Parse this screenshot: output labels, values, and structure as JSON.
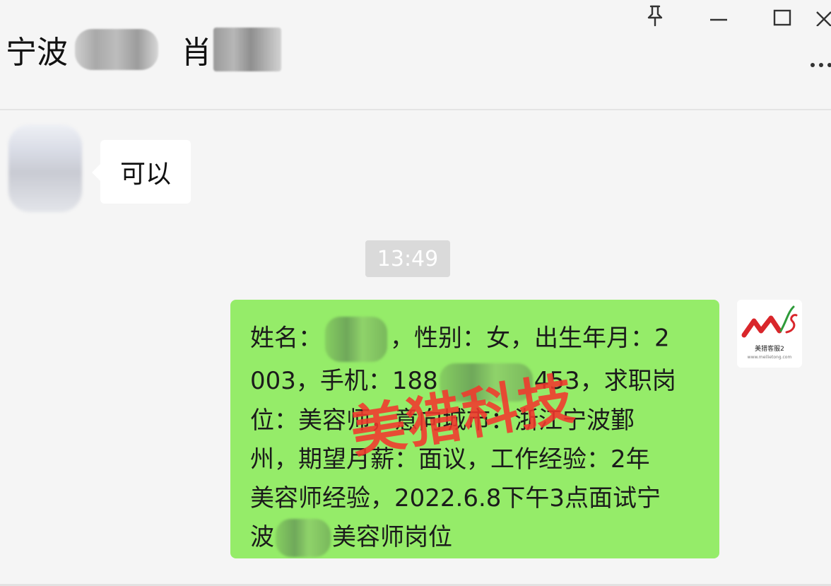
{
  "window": {
    "pin_icon": "pin-icon",
    "minimize_icon": "minimize-icon",
    "maximize_icon": "maximize-icon",
    "close_icon": "close-icon",
    "more_icon": "more-icon"
  },
  "header": {
    "title_part1": "宁波",
    "title_part2": "肖"
  },
  "messages": {
    "incoming_text": "可以",
    "timestamp": "13:49",
    "outgoing_lines": {
      "line1_a": "姓名：",
      "line1_b": "，性别：女，出生年月：2",
      "line2_a": "003，手机：188",
      "line2_b": "453，求职岗",
      "line3": "位：美容师，意向城市：浙江宁波鄞",
      "line4": "州，期望月薪：面议，工作经验：2年",
      "line5": "美容师经验，2022.6.8下午3点面试宁",
      "line6_a": "波",
      "line6_b": "美容师岗位"
    }
  },
  "watermark": {
    "text": "美猎科技"
  },
  "avatar_logo": {
    "brand_text": "美猎客服2",
    "sub_text": "www.meilietong.com"
  },
  "colors": {
    "outgoing_bubble": "#95ec69",
    "incoming_bubble": "#ffffff",
    "background": "#f5f5f5",
    "watermark": "#f2372c",
    "logo_red": "#d9262b",
    "logo_green": "#2e9b3a"
  }
}
